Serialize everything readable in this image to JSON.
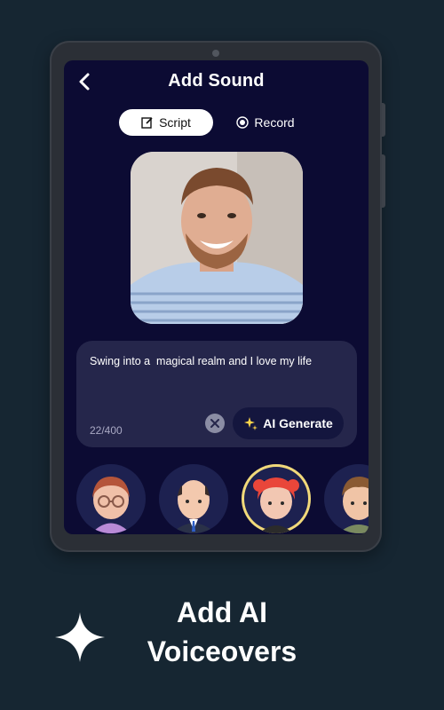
{
  "header": {
    "title": "Add Sound",
    "back_icon": "chevron-left-icon"
  },
  "tabs": [
    {
      "label": "Script",
      "icon": "edit-icon",
      "active": true
    },
    {
      "label": "Record",
      "icon": "record-icon",
      "active": false
    }
  ],
  "script": {
    "text": "Swing into a  magical realm and I love my life",
    "counter": "22/400",
    "ai_generate_label": "AI Generate"
  },
  "avatars": [
    {
      "name": "avatar-woman-glasses",
      "selected": false
    },
    {
      "name": "avatar-man-bald",
      "selected": false
    },
    {
      "name": "avatar-girl-redhead",
      "selected": true
    },
    {
      "name": "avatar-man-brown-hair",
      "selected": false
    }
  ],
  "footer": {
    "line1": "Add AI",
    "line2": "Voiceovers"
  },
  "colors": {
    "background": "#162632",
    "screen": "#0c0b33",
    "accent_ring": "#f1d97a"
  }
}
